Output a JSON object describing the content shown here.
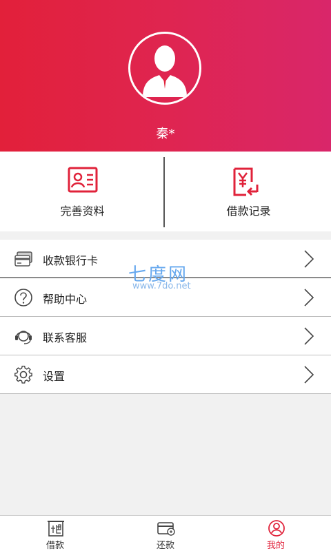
{
  "profile": {
    "username": "秦*"
  },
  "quick_actions": [
    {
      "label": "完善资料",
      "icon": "id-card-icon"
    },
    {
      "label": "借款记录",
      "icon": "loan-record-icon"
    }
  ],
  "menu": [
    {
      "label": "收款银行卡",
      "icon": "bank-card-icon"
    },
    {
      "label": "帮助中心",
      "icon": "help-icon"
    },
    {
      "label": "联系客服",
      "icon": "headset-icon"
    },
    {
      "label": "设置",
      "icon": "gear-icon"
    }
  ],
  "watermark": {
    "title": "七度网",
    "url": "www.7do.net"
  },
  "tabs": [
    {
      "label": "借款",
      "icon": "loan-tab-icon",
      "active": false
    },
    {
      "label": "还款",
      "icon": "repay-tab-icon",
      "active": false
    },
    {
      "label": "我的",
      "icon": "profile-tab-icon",
      "active": true
    }
  ],
  "colors": {
    "brand_red": "#e0223a",
    "brand_pink": "#d9266a",
    "background": "#f1f1f1"
  }
}
